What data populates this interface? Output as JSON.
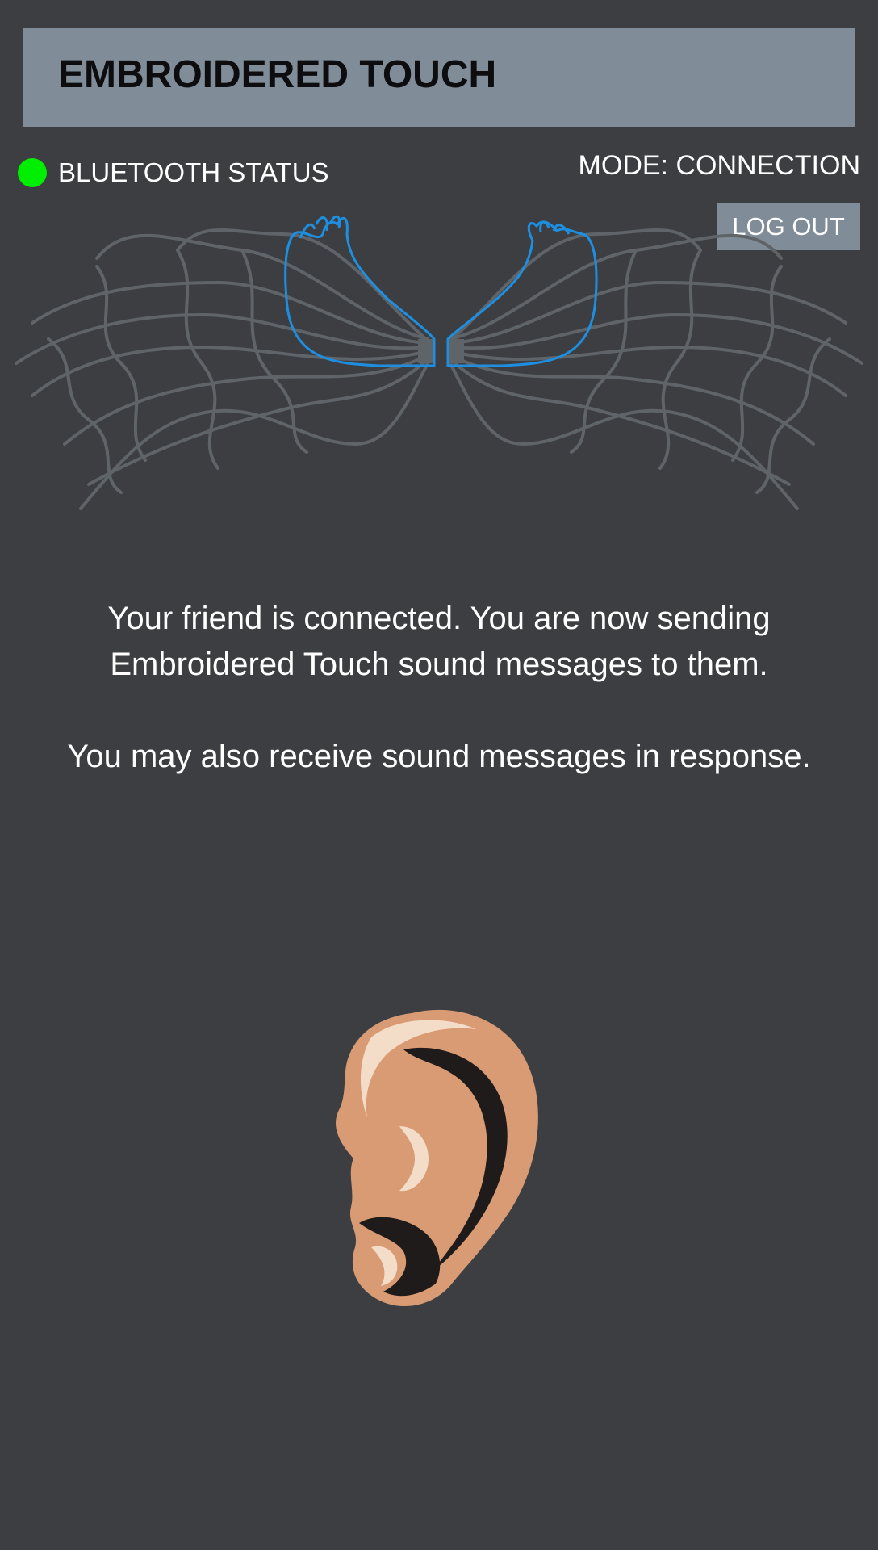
{
  "header": {
    "title": "EMBROIDERED TOUCH"
  },
  "status": {
    "bluetooth_label": "BLUETOOTH STATUS",
    "bluetooth_color": "#00ee00",
    "mode_label": "MODE: CONNECTION"
  },
  "actions": {
    "logout_label": "LOG OUT"
  },
  "message": {
    "line1": "Your friend is connected. You are now sending Embroidered Touch sound messages to them.",
    "line2": "You may also receive sound messages in response."
  },
  "icons": {
    "hands": "embroidered-hands-icon",
    "ear": "ear-icon"
  },
  "colors": {
    "background": "#3d3e42",
    "header": "#808d99",
    "hand_outline": "#1e8fe0",
    "threads": "#5f6468",
    "ear": "#d99b74"
  }
}
